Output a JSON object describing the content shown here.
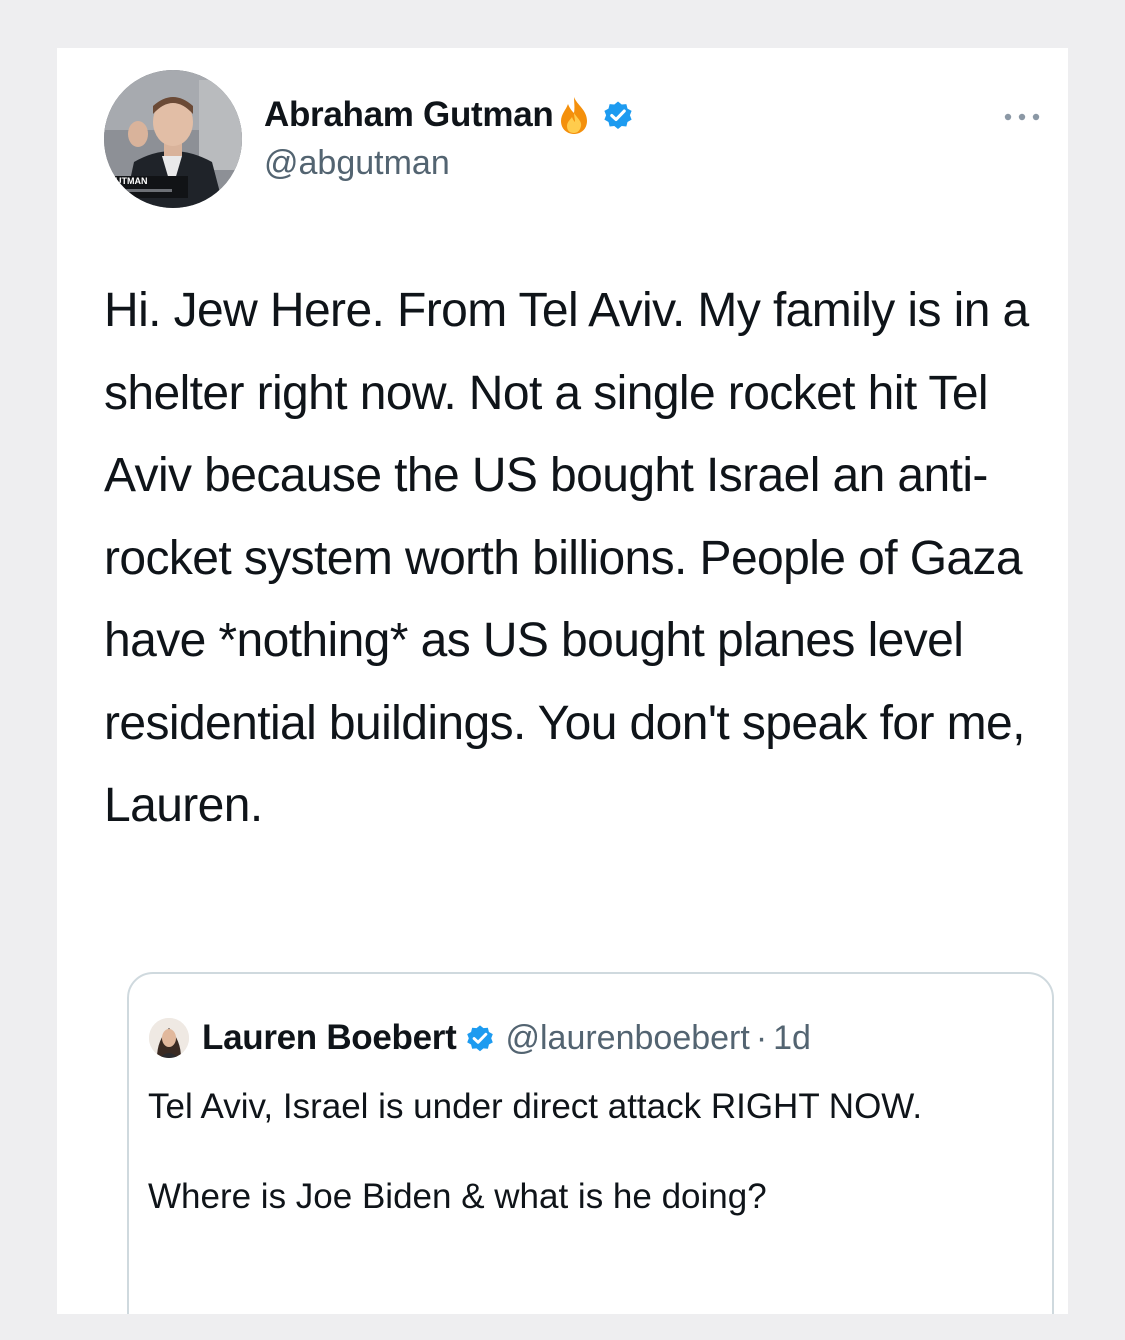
{
  "tweet": {
    "author_name": "Abraham Gutman",
    "author_handle": "@abgutman",
    "avatar_badge_text": "GUTMAN",
    "text": "Hi. Jew Here. From Tel Aviv. My family is in a shelter right now. Not a single rocket hit Tel Aviv because the US bought Israel an anti-rocket system worth billions. People of Gaza have *nothing* as US bought planes level residential buildings. You don't speak for me, Lauren.",
    "icons": [
      "fire-icon",
      "verified-icon",
      "more-icon"
    ]
  },
  "quoted_tweet": {
    "author_name": "Lauren Boebert",
    "author_handle": "@laurenboebert",
    "separator": "·",
    "time": "1d",
    "text_line1": "Tel Aviv, Israel is under direct attack RIGHT NOW.",
    "text_line2": "Where is Joe Biden & what is he doing?"
  },
  "colors": {
    "page_background": "#eeeef0",
    "card_background": "#ffffff",
    "text_primary": "#0f1419",
    "text_secondary": "#536471",
    "verified_blue": "#1d9bf0",
    "fire_orange": "#f4900c",
    "quote_border": "#cfd9de"
  }
}
